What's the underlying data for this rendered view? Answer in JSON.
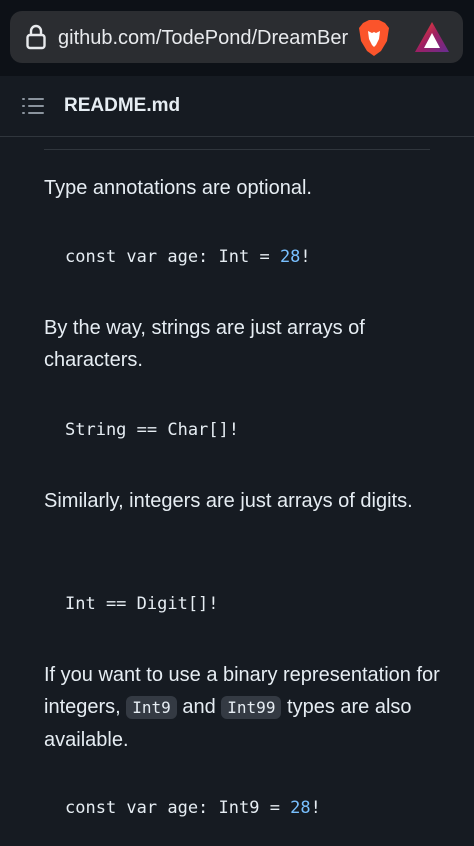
{
  "browser": {
    "url": "github.com/TodePond/DreamBerd",
    "icons": [
      "lock-icon",
      "brave-lion-icon",
      "brave-rewards-icon"
    ]
  },
  "readme": {
    "title": "README.md"
  },
  "content": {
    "p1": "Type annotations are optional.",
    "code1": {
      "before": "const var age: Int = ",
      "number": "28",
      "after": "!"
    },
    "p2": "By the way, strings are just arrays of characters.",
    "code2": "String == Char[]!",
    "p3": "Similarly, integers are just arrays of digits.",
    "code3": "Int == Digit[]!",
    "p4": {
      "text1": "If you want to use a binary representation for integers, ",
      "inline1": "Int9",
      "text2": " and ",
      "inline2": "Int99",
      "text3": " types are also available."
    },
    "code4": {
      "before": "const var age: Int9 = ",
      "number": "28",
      "after": "!"
    }
  },
  "colors": {
    "background": "#0d1117",
    "panel": "#161b22",
    "number": "#79c0ff",
    "brave_orange": "#fb542b"
  }
}
